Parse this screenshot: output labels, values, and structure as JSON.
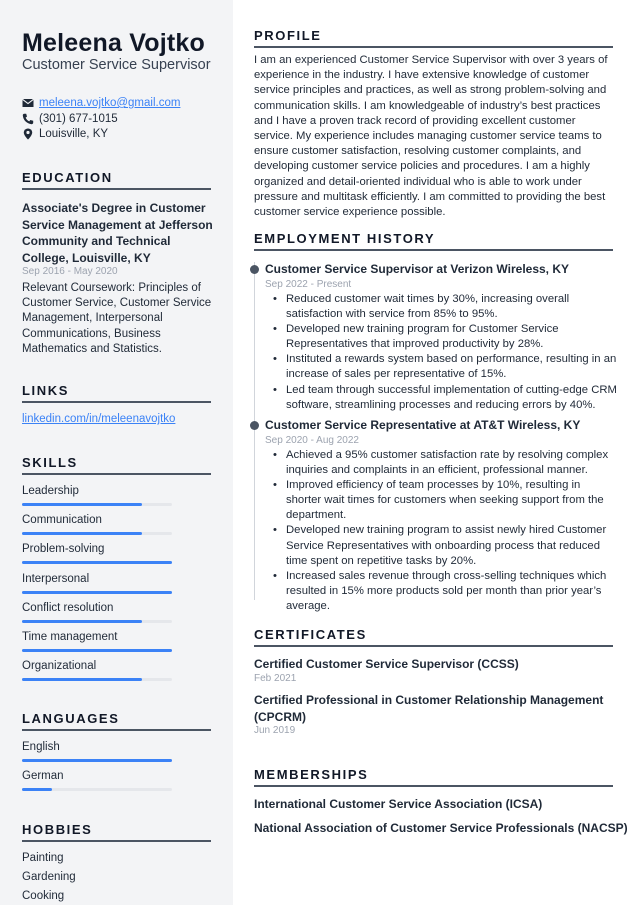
{
  "header": {
    "name": "Meleena Vojtko",
    "title": "Customer Service Supervisor"
  },
  "contact": {
    "email": "meleena.vojtko@gmail.com",
    "phone": "(301) 677-1015",
    "location": "Louisville, KY",
    "icons": {
      "email": "envelope-icon",
      "phone": "phone-icon",
      "location": "map-pin-icon"
    }
  },
  "sections": {
    "education": "EDUCATION",
    "links": "LINKS",
    "skills": "SKILLS",
    "languages": "LANGUAGES",
    "hobbies": "HOBBIES",
    "profile": "PROFILE",
    "employment": "EMPLOYMENT HISTORY",
    "certificates": "CERTIFICATES",
    "memberships": "MEMBERSHIPS"
  },
  "education": {
    "degree": "Associate's Degree in Customer Service Management at Jefferson Community and Technical College, Louisville, KY",
    "date": "Sep 2016 - May 2020",
    "description": "Relevant Coursework: Principles of Customer Service, Customer Service Management, Interpersonal Communications, Business Mathematics and Statistics."
  },
  "links": [
    {
      "label": "linkedin.com/in/meleenavojtko"
    }
  ],
  "skills": [
    {
      "name": "Leadership",
      "level": 0.8
    },
    {
      "name": "Communication",
      "level": 0.8
    },
    {
      "name": "Problem-solving",
      "level": 1.0
    },
    {
      "name": "Interpersonal",
      "level": 1.0
    },
    {
      "name": "Conflict resolution",
      "level": 0.8
    },
    {
      "name": "Time management",
      "level": 1.0
    },
    {
      "name": "Organizational",
      "level": 0.8
    }
  ],
  "languages": [
    {
      "name": "English",
      "level": 1.0
    },
    {
      "name": "German",
      "level": 0.2
    }
  ],
  "hobbies": [
    "Painting",
    "Gardening",
    "Cooking"
  ],
  "profile": "I am an experienced Customer Service Supervisor with over 3 years of experience in the industry. I have extensive knowledge of customer service principles and practices, as well as strong problem-solving and communication skills. I am knowledgeable of industry’s best practices and I have a proven track record of providing excellent customer service. My experience includes managing customer service teams to ensure customer satisfaction, resolving customer complaints, and developing customer service policies and procedures. I am a highly organized and detail-oriented individual who is able to work under pressure and multitask efficiently. I am committed to providing the best customer service experience possible.",
  "employment": [
    {
      "title": "Customer Service Supervisor at Verizon Wireless, KY",
      "date": "Sep 2022 - Present",
      "bullets": [
        "Reduced customer wait times by 30%, increasing overall satisfaction with service from 85% to 95%.",
        "Developed new training program for Customer Service Representatives that improved productivity by 28%.",
        "Instituted a rewards system based on performance, resulting in an increase of sales per representative of 15%.",
        "Led team through successful implementation of cutting-edge CRM software, streamlining processes and reducing errors by 40%."
      ]
    },
    {
      "title": "Customer Service Representative at AT&T Wireless, KY",
      "date": "Sep 2020 - Aug 2022",
      "bullets": [
        "Achieved a 95% customer satisfaction rate by resolving complex inquiries and complaints in an efficient, professional manner.",
        "Improved efficiency of team processes by 10%, resulting in shorter wait times for customers when seeking support from the department.",
        "Developed new training program to assist newly hired Customer Service Representatives with onboarding process that reduced time spent on repetitive tasks by 20%.",
        "Increased sales revenue through cross-selling techniques which resulted in 15% more products sold per month than prior year’s average."
      ]
    }
  ],
  "certificates": [
    {
      "name": "Certified Customer Service Supervisor (CCSS)",
      "date": "Feb 2021"
    },
    {
      "name": "Certified Professional in Customer Relationship Management (CPCRM)",
      "date": "Jun 2019"
    }
  ],
  "memberships": [
    "International Customer Service Association (ICSA)",
    "National Association of Customer Service Professionals (NACSP)"
  ],
  "colors": {
    "accent": "#3b82f6",
    "sidebar_bg": "#f3f4f6",
    "text": "#1f2937",
    "muted": "#9ca3af",
    "rule": "#4b5563"
  }
}
